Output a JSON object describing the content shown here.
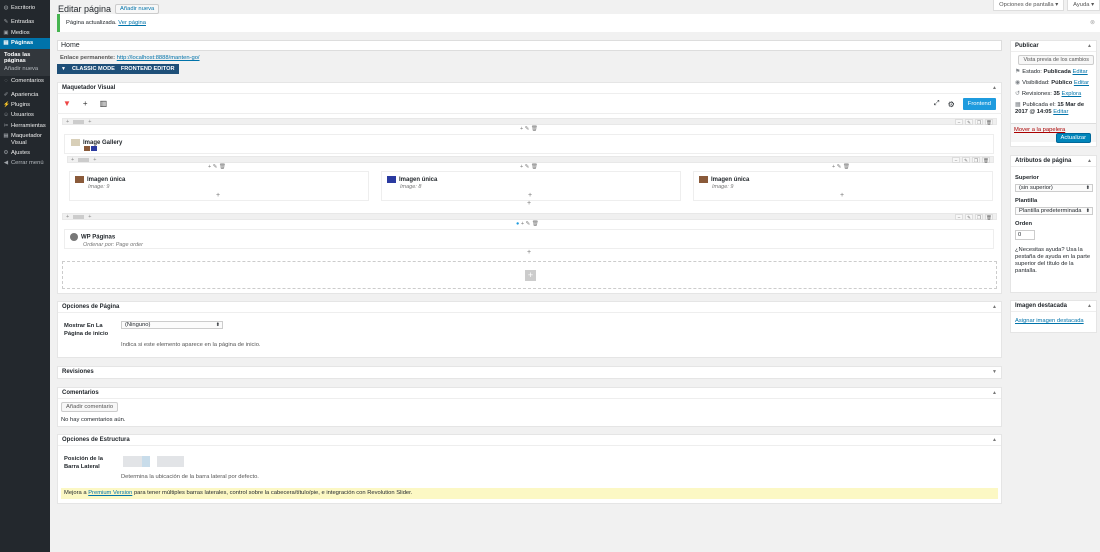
{
  "sidebar": {
    "items": [
      {
        "label": "Escritorio",
        "icon": "dashboard-icon",
        "glyph": "◍"
      },
      {
        "label": "Entradas",
        "icon": "pin-icon",
        "glyph": "✎"
      },
      {
        "label": "Medios",
        "icon": "media-icon",
        "glyph": "▣"
      },
      {
        "label": "Páginas",
        "icon": "pages-icon",
        "glyph": "▤"
      },
      {
        "label": "Comentarios",
        "icon": "comments-icon",
        "glyph": "◌"
      },
      {
        "label": "Apariencia",
        "icon": "appearance-icon",
        "glyph": "✐"
      },
      {
        "label": "Plugins",
        "icon": "plugins-icon",
        "glyph": "⚡"
      },
      {
        "label": "Usuarios",
        "icon": "users-icon",
        "glyph": "☺"
      },
      {
        "label": "Herramientas",
        "icon": "tools-icon",
        "glyph": "✂"
      },
      {
        "label": "Maquetador Visual",
        "icon": "builder-icon",
        "glyph": "▦"
      },
      {
        "label": "Ajustes",
        "icon": "settings-icon",
        "glyph": "⚙"
      },
      {
        "label": "Cerrar menú",
        "icon": "collapse-icon",
        "glyph": "◀"
      }
    ],
    "submenu": [
      "Todas las páginas",
      "Añadir nueva"
    ]
  },
  "top": {
    "screen_options": "Opciones de pantalla ▾",
    "help": "Ayuda ▾"
  },
  "header": {
    "title": "Editar página",
    "add_new": "Añadir nueva"
  },
  "notice": {
    "text": "Página actualizada.",
    "link": "Ver página",
    "dismiss": "⊗"
  },
  "editor": {
    "title_value": "Home",
    "permalink_label": "Enlace permanente:",
    "permalink_url": "http://localhost:8888/manten-go/",
    "classic_mode": "CLASSIC MODE",
    "frontend_editor": "FRONTEND EDITOR"
  },
  "builder": {
    "title": "Maquetador Visual",
    "frontend_btn": "Frontend",
    "modules": {
      "gallery": {
        "title": "Image Gallery"
      },
      "img1": {
        "title": "Imagen única",
        "sub": "Image: 9"
      },
      "img2": {
        "title": "Imagen única",
        "sub": "Image: 8"
      },
      "img3": {
        "title": "Imagen única",
        "sub": "Image: 9"
      },
      "wp": {
        "title": "WP Páginas",
        "sub": "Ordenar por: Page order"
      }
    }
  },
  "page_options": {
    "title": "Opciones de Página",
    "field_label": "Mostrar En La Página de inicio",
    "select_value": "(Ninguno)",
    "description": "Indica si este elemento aparece en la página de inicio."
  },
  "revisions": {
    "title": "Revisiones"
  },
  "comments": {
    "title": "Comentarios",
    "add_btn": "Añadir comentario",
    "empty": "No hay comentarios aún."
  },
  "structure": {
    "title": "Opciones de Estructura",
    "field_label": "Posición de la Barra Lateral",
    "description": "Determina la ubicación de la barra lateral por defecto.",
    "upsell_pre": "Mejora a",
    "upsell_link": "Premium Version",
    "upsell_post": "para tener múltiples barras laterales, control sobre la cabecera/título/pie, e integración con Revolution Slider."
  },
  "publish": {
    "title": "Publicar",
    "preview": "Vista previa de los cambios",
    "status_label": "Estado:",
    "status_value": "Publicada",
    "visibility_label": "Visibilidad:",
    "visibility_value": "Público",
    "revisions_label": "Revisiones:",
    "revisions_value": "35",
    "revisions_link": "Explora",
    "published_label": "Publicada el:",
    "published_value": "15 Mar de 2017 @ 14:05",
    "edit": "Editar",
    "trash": "Mover a la papelera",
    "update": "Actualizar"
  },
  "attributes": {
    "title": "Atributos de página",
    "parent_label": "Superior",
    "parent_value": "(sin superior)",
    "template_label": "Plantilla",
    "template_value": "Plantilla predeterminada",
    "order_label": "Orden",
    "order_value": "0",
    "help": "¿Necesitas ayuda? Usa la pestaña de ayuda en la parte superior del título de la pantalla."
  },
  "featured": {
    "title": "Imagen destacada",
    "link": "Asignar imagen destacada"
  },
  "colors": {
    "accent": "#0073aa",
    "builder_btn": "#1e9bde",
    "mode_bar": "#1e4f78"
  }
}
